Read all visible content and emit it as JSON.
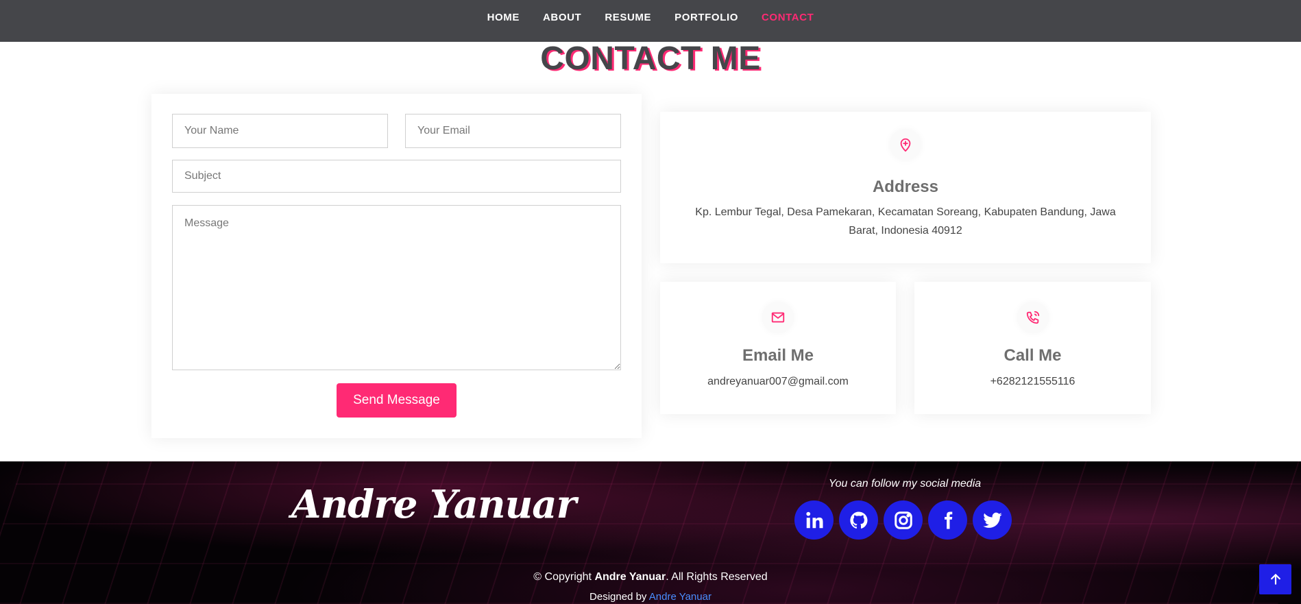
{
  "nav": {
    "items": [
      {
        "label": "HOME",
        "active": false
      },
      {
        "label": "ABOUT",
        "active": false
      },
      {
        "label": "RESUME",
        "active": false
      },
      {
        "label": "PORTFOLIO",
        "active": false
      },
      {
        "label": "CONTACT",
        "active": true
      }
    ]
  },
  "section": {
    "title": "CONTACT ME"
  },
  "form": {
    "name_placeholder": "Your Name",
    "email_placeholder": "Your Email",
    "subject_placeholder": "Subject",
    "message_placeholder": "Message",
    "submit_label": "Send Message"
  },
  "cards": {
    "address": {
      "icon": "map-pin-plus-icon",
      "title": "Address",
      "text": "Kp. Lembur Tegal, Desa Pamekaran, Kecamatan Soreang, Kabupaten Bandung, Jawa Barat, Indonesia 40912"
    },
    "email": {
      "icon": "envelope-icon",
      "title": "Email Me",
      "text": "andreyanuar007@gmail.com"
    },
    "call": {
      "icon": "phone-call-icon",
      "title": "Call Me",
      "text": "+6282121555116"
    }
  },
  "footer": {
    "brand": "Andre Yanuar",
    "follow_text": "You can follow my social media",
    "social": [
      "linkedin-icon",
      "github-icon",
      "instagram-icon",
      "facebook-icon",
      "twitter-icon"
    ],
    "copyright_prefix": "© Copyright ",
    "copyright_name": "Andre Yanuar",
    "copyright_suffix": ". All Rights Reserved",
    "designed_prefix": "Designed by ",
    "designed_link": "Andre Yanuar"
  },
  "colors": {
    "accent": "#ff2a74",
    "navbar": "#45464a",
    "social": "#1f1fe6",
    "link": "#4a8dff"
  }
}
